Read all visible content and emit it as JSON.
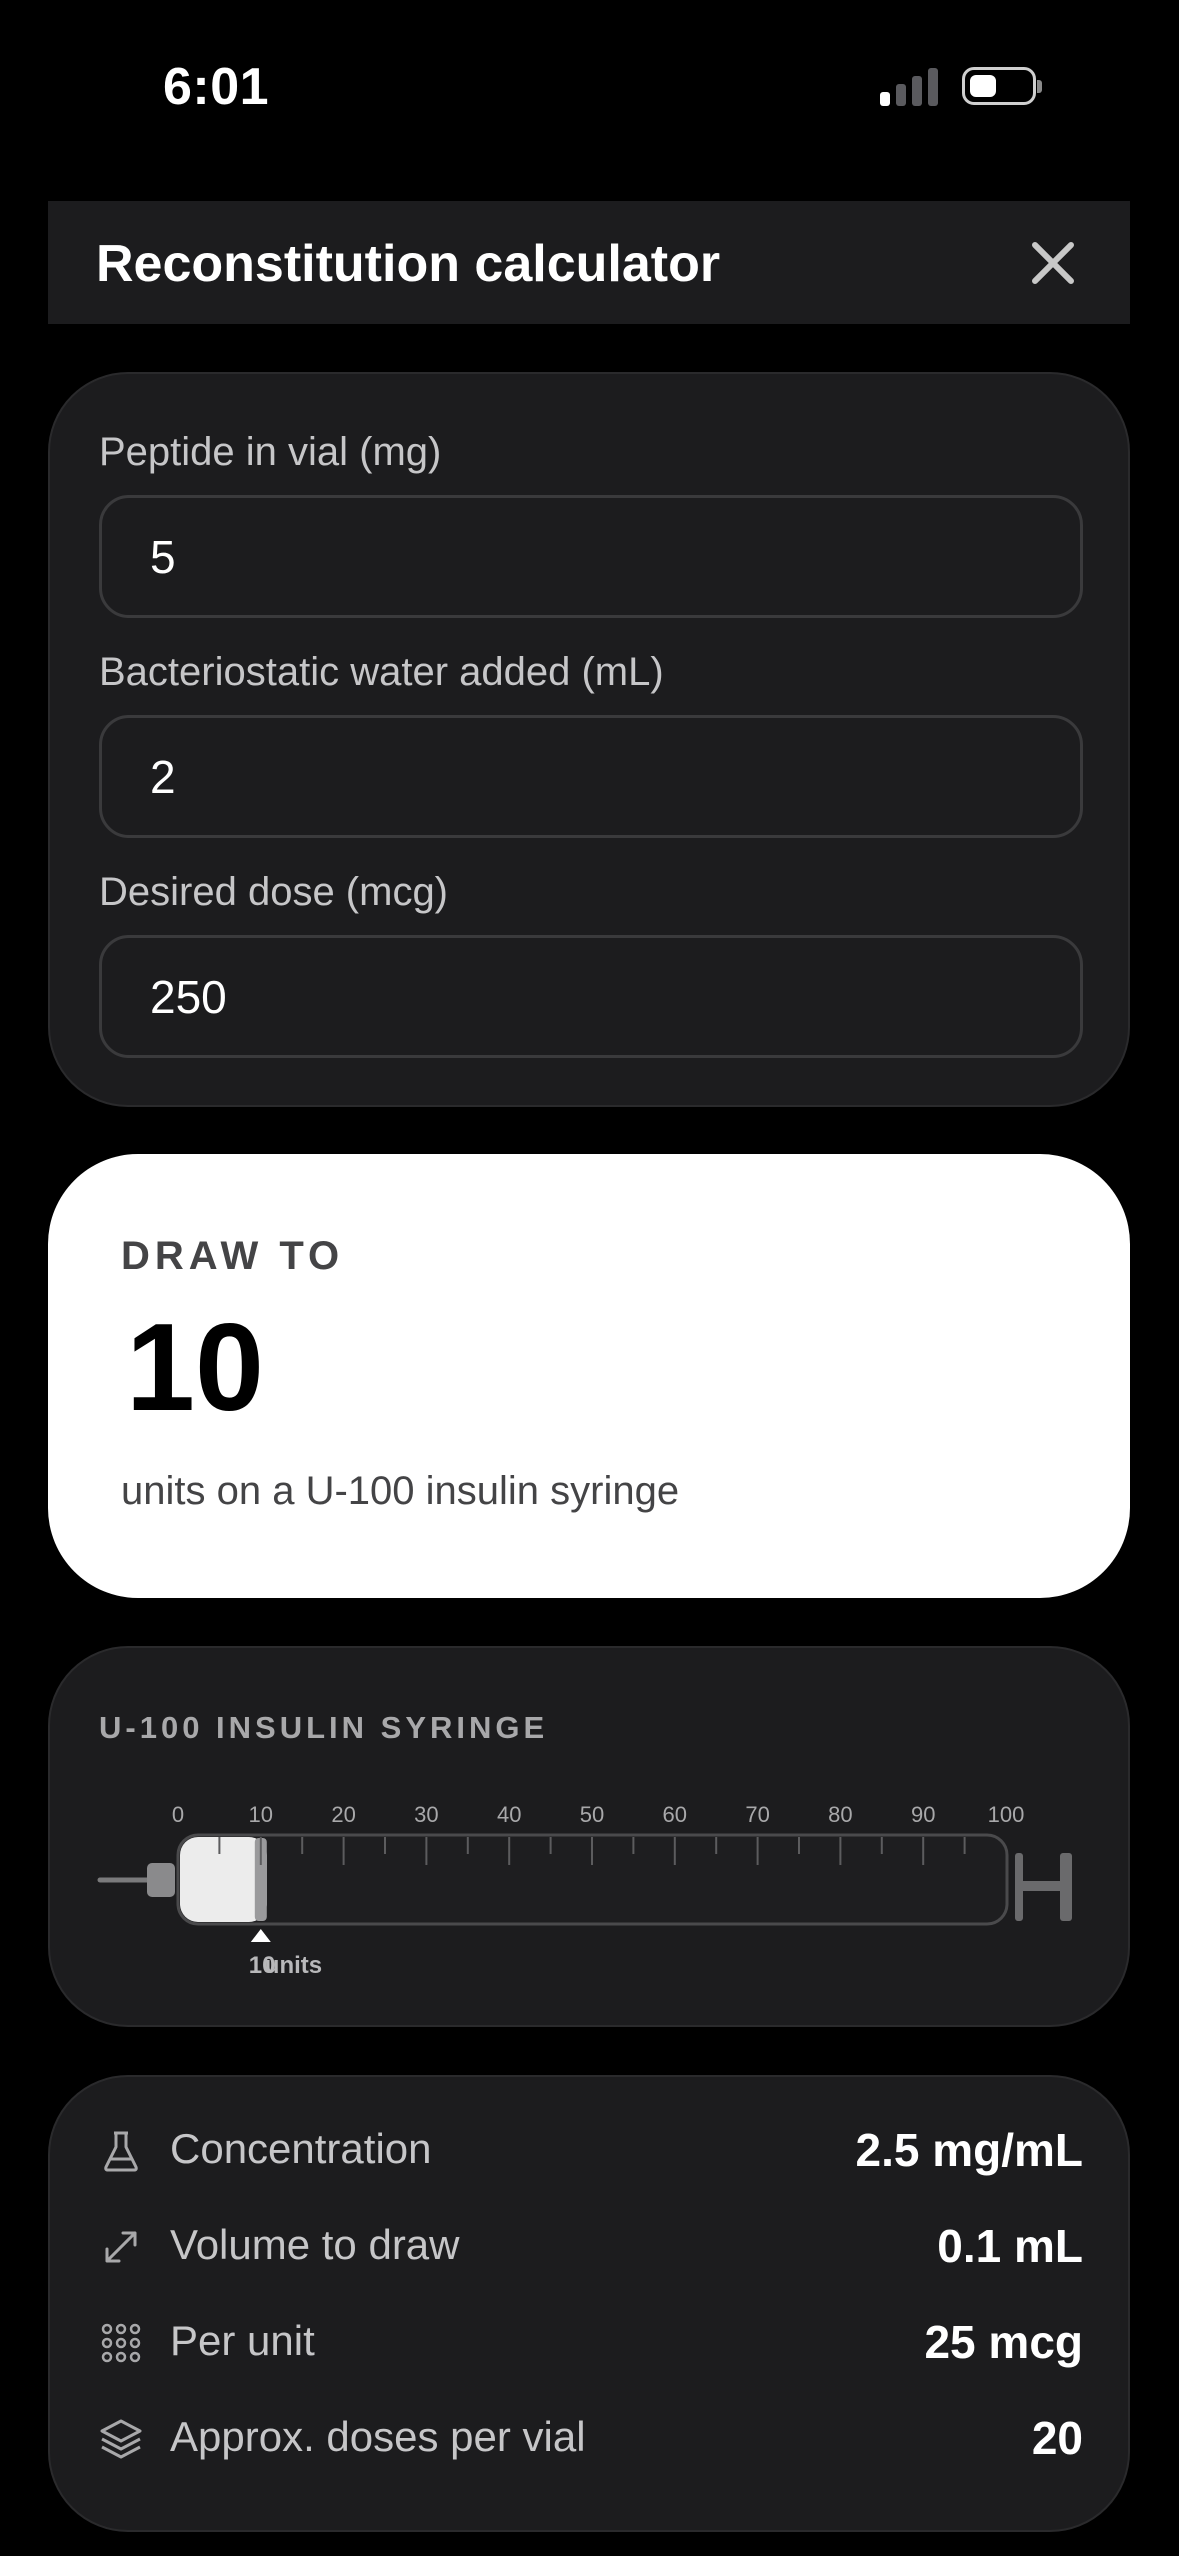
{
  "status_bar": {
    "time": "6:01"
  },
  "header": {
    "title": "Reconstitution calculator"
  },
  "inputs": {
    "peptide_label": "Peptide in vial (mg)",
    "peptide_value": "5",
    "water_label": "Bacteriostatic water added (mL)",
    "water_value": "2",
    "dose_label": "Desired dose (mcg)",
    "dose_value": "250"
  },
  "result": {
    "kicker": "DRAW TO",
    "value": "10",
    "subtitle": "units on a U-100 insulin syringe"
  },
  "syringe": {
    "title": "U-100 INSULIN SYRINGE",
    "scale_max": 100,
    "ticks": [
      "0",
      "10",
      "20",
      "30",
      "40",
      "50",
      "60",
      "70",
      "80",
      "90",
      "100"
    ],
    "fill_units": 10,
    "marker_number": "10",
    "marker_unit": "units"
  },
  "stats": [
    {
      "icon": "flask-icon",
      "label": "Concentration",
      "value": "2.5 mg/mL"
    },
    {
      "icon": "diagonal-arrows-icon",
      "label": "Volume to draw",
      "value": "0.1 mL"
    },
    {
      "icon": "dot-grid-icon",
      "label": "Per unit",
      "value": "25 mcg"
    },
    {
      "icon": "stack-layers-icon",
      "label": "Approx. doses per vial",
      "value": "20"
    }
  ]
}
